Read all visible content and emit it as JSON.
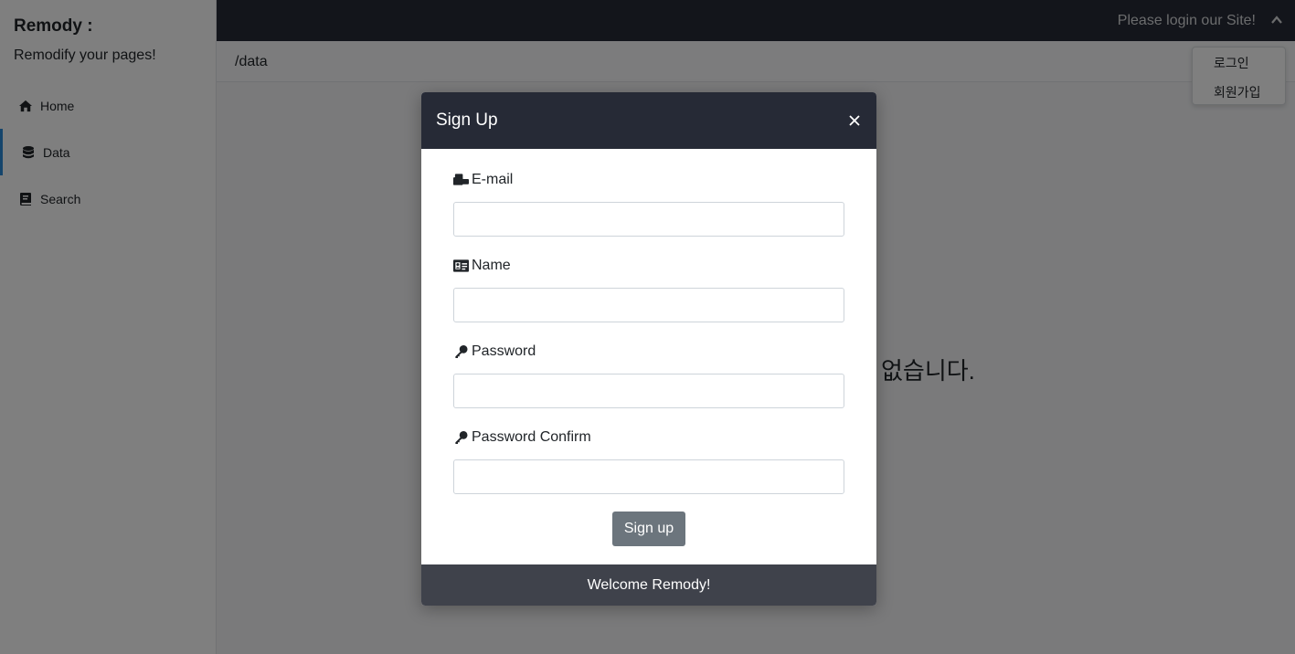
{
  "sidebar": {
    "title": "Remody :",
    "subtitle": "Remodify your pages!",
    "items": [
      {
        "label": "Home",
        "icon": "home-icon"
      },
      {
        "label": "Data",
        "icon": "database-icon",
        "active": true
      },
      {
        "label": "Search",
        "icon": "book-icon"
      }
    ]
  },
  "topbar": {
    "message": "Please login our Site!",
    "toggle_icon": "chevron-up-icon"
  },
  "path": "/data",
  "main": {
    "message_partial": "없습니다."
  },
  "dropdown": {
    "items": [
      "로그인",
      "회원가입"
    ]
  },
  "modal": {
    "title": "Sign Up",
    "close_icon": "close-icon",
    "fields": [
      {
        "label": "E-mail",
        "icon": "mail-bulk-icon",
        "value": ""
      },
      {
        "label": "Name",
        "icon": "id-card-icon",
        "value": ""
      },
      {
        "label": "Password",
        "icon": "key-icon",
        "value": ""
      },
      {
        "label": "Password Confirm",
        "icon": "key-icon",
        "value": ""
      }
    ],
    "submit_label": "Sign up",
    "footer": "Welcome Remody!"
  }
}
